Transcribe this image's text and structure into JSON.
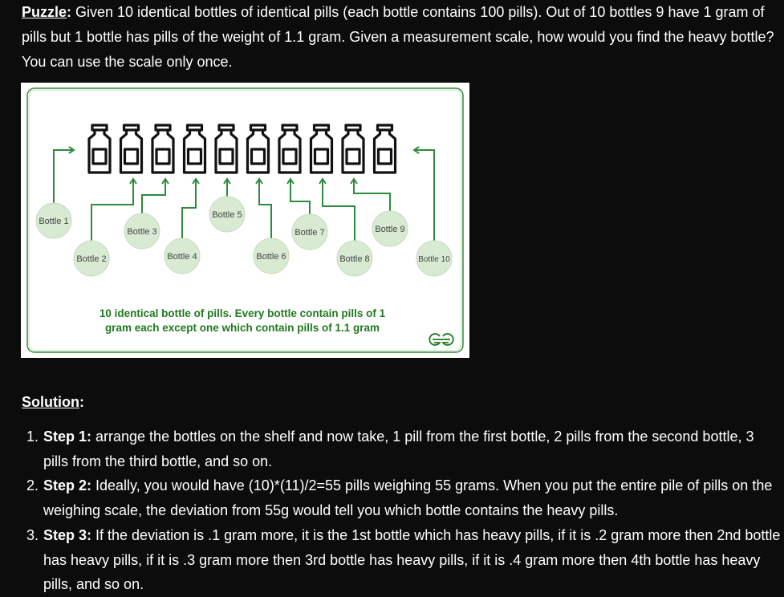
{
  "puzzle": {
    "label": "Puzzle",
    "colon": ":",
    "text": " Given 10 identical bottles of identical pills (each bottle contains 100 pills). Out of 10 bottles 9 have 1 gram of pills but 1 bottle has pills of the weight of 1.1 gram. Given a measurement scale, how would you find the heavy bottle? You can use the scale only once."
  },
  "figure": {
    "bottles": [
      "Bottle 1",
      "Bottle 2",
      "Bottle 3",
      "Bottle 4",
      "Bottle 5",
      "Bottle 6",
      "Bottle 7",
      "Bottle 8",
      "Bottle 9",
      "Bottle 10"
    ],
    "caption_line1": "10 identical bottle of pills. Every bottle contain pills of 1",
    "caption_line2": "gram each except one which contain pills of 1.1 gram",
    "logo": "GfG",
    "colors": {
      "bubble": "#d9ead3",
      "arrow": "#2e8b3d",
      "caption": "#1f7a1f",
      "bottle": "#111111"
    }
  },
  "solution": {
    "heading": "Solution",
    "colon": ":",
    "steps": [
      {
        "num": "1.",
        "label": "Step 1:",
        "text": " arrange the bottles on the shelf and now take, 1 pill from the first bottle, 2 pills from the second bottle, 3 pills from the third bottle, and so on."
      },
      {
        "num": "2.",
        "label": "Step 2:",
        "text": " Ideally, you would have (10)*(11)/2=55 pills weighing 55 grams. When you put the entire pile of pills on the weighing scale, the deviation from 55g would tell you which bottle contains the heavy pills."
      },
      {
        "num": "3.",
        "label": "Step 3:",
        "text": " If the deviation is .1 gram more, it is the 1st bottle which has heavy pills, if it is .2 gram more then 2nd bottle has heavy pills, if it is .3 gram more then 3rd bottle has heavy pills, if it is .4 gram more then 4th bottle has heavy pills, and so on."
      }
    ]
  }
}
